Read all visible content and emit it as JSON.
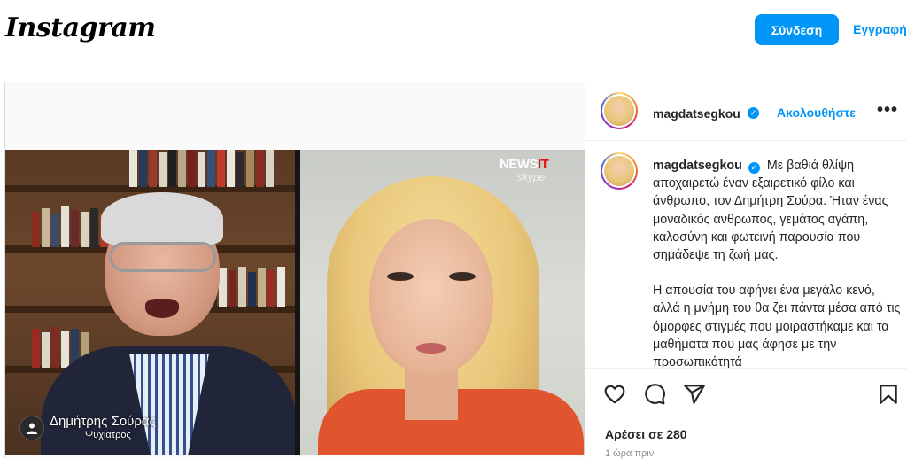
{
  "header": {
    "logo_text": "Instagram",
    "login_label": "Σύνδεση",
    "signup_label": "Εγγραφή"
  },
  "video": {
    "overlay_brand": "NEWS",
    "overlay_brand_suffix": "IT",
    "overlay_sub": "skype",
    "caption_name": "Δημήτρης Σούρας",
    "caption_role": "Ψυχίατρος"
  },
  "post": {
    "username": "magdatsegkou",
    "follow_label": "Ακολουθήστε",
    "caption_paragraph_1": "Με βαθιά θλίψη αποχαιρετώ έναν εξαιρετικό φίλο και άνθρωπο, τον Δημήτρη Σούρα. Ήταν ένας μοναδικός άνθρωπος, γεμάτος αγάπη, καλοσύνη και φωτεινή παρουσία που σημάδεψε τη ζωή μας.",
    "caption_paragraph_2": "Η απουσία του αφήνει ένα μεγάλο κενό, αλλά η μνήμη του θα ζει πάντα μέσα από τις όμορφες στιγμές που μοιραστήκαμε και τα μαθήματα που μας άφησε με την προσωπικότητά",
    "likes_text": "Αρέσει σε 280",
    "timestamp": "1 ώρα πριν"
  },
  "icons": {
    "like": "heart-icon",
    "comment": "comment-icon",
    "share": "share-icon",
    "save": "bookmark-icon",
    "more": "more-icon",
    "verified": "verified-badge-icon"
  },
  "colors": {
    "accent": "#0095f6",
    "border": "#dbdbdb",
    "muted": "#8e8e8e"
  }
}
